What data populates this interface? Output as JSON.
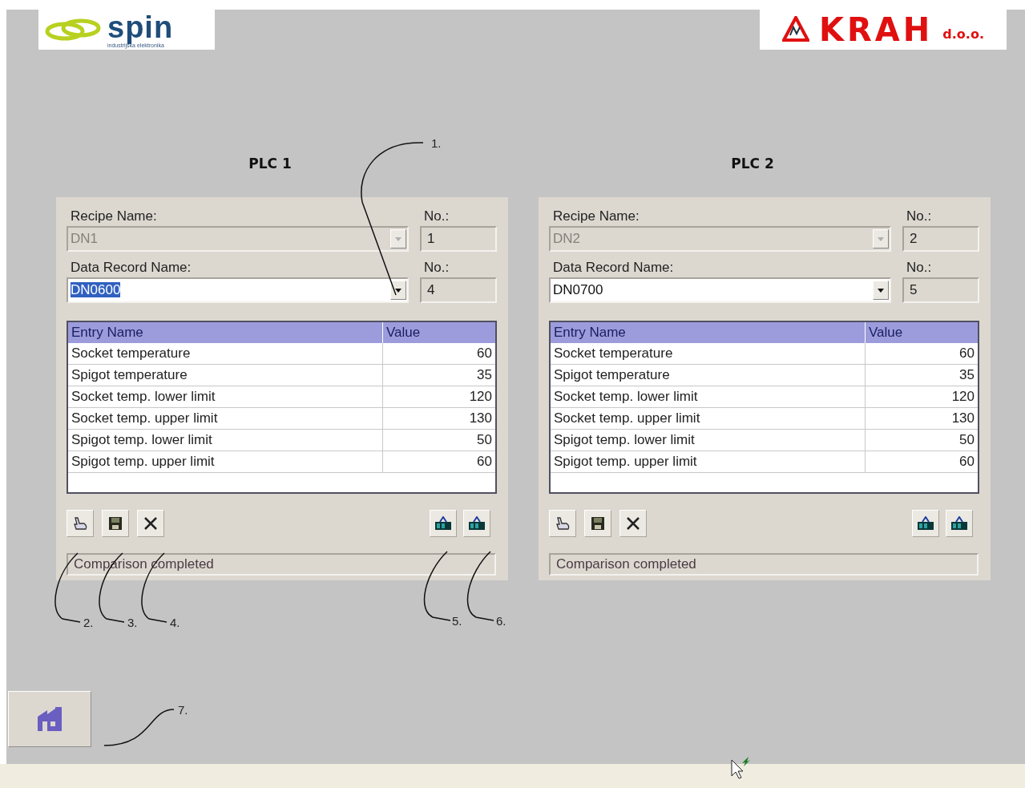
{
  "logos": {
    "left": {
      "name": "spin",
      "tagline": "industrijska elektronika"
    },
    "right": {
      "name": "KRAH",
      "suffix": "d.o.o."
    }
  },
  "plcs": [
    {
      "title": "PLC 1",
      "recipe": {
        "label": "Recipe Name:",
        "value": "DN1",
        "disabled": true
      },
      "recipe_no": {
        "label": "No.:",
        "value": "1"
      },
      "record": {
        "label": "Data Record Name:",
        "value": "DN0600",
        "disabled": false,
        "text_selected": true
      },
      "record_no": {
        "label": "No.:",
        "value": "4"
      },
      "table": {
        "columns": [
          "Entry Name",
          "Value"
        ],
        "rows": [
          [
            "Socket temperature",
            "60"
          ],
          [
            "Spigot temperature",
            "35"
          ],
          [
            "Socket temp. lower limit",
            "120"
          ],
          [
            "Socket temp. upper limit",
            "130"
          ],
          [
            "Spigot temp. lower limit",
            "50"
          ],
          [
            "Spigot temp. upper limit",
            "60"
          ]
        ]
      },
      "status": "Comparison completed"
    },
    {
      "title": "PLC 2",
      "recipe": {
        "label": "Recipe Name:",
        "value": "DN2",
        "disabled": true
      },
      "recipe_no": {
        "label": "No.:",
        "value": "2"
      },
      "record": {
        "label": "Data Record Name:",
        "value": "DN0700",
        "disabled": false,
        "text_selected": false
      },
      "record_no": {
        "label": "No.:",
        "value": "5"
      },
      "table": {
        "columns": [
          "Entry Name",
          "Value"
        ],
        "rows": [
          [
            "Socket temperature",
            "60"
          ],
          [
            "Spigot temperature",
            "35"
          ],
          [
            "Socket temp. lower limit",
            "120"
          ],
          [
            "Socket temp. upper limit",
            "130"
          ],
          [
            "Spigot temp. lower limit",
            "50"
          ],
          [
            "Spigot temp. upper limit",
            "60"
          ]
        ]
      },
      "status": "Comparison completed"
    }
  ],
  "annotations": [
    {
      "label": "1."
    },
    {
      "label": "2."
    },
    {
      "label": "3."
    },
    {
      "label": "4."
    },
    {
      "label": "5."
    },
    {
      "label": "6."
    },
    {
      "label": "7."
    }
  ]
}
